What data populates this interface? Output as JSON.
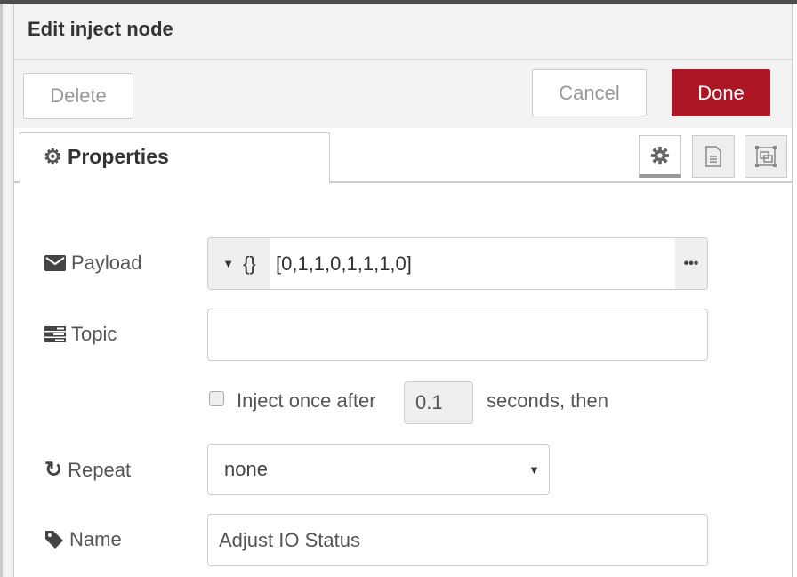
{
  "dialog": {
    "title": "Edit inject node"
  },
  "toolbar": {
    "delete": "Delete",
    "cancel": "Cancel",
    "done": "Done",
    "done_color": "#ad1625"
  },
  "tabs": {
    "properties": "Properties"
  },
  "tab_icons": [
    "gear-icon",
    "file-text-icon",
    "expand-icon"
  ],
  "form": {
    "payload": {
      "label": "Payload",
      "type_icon": "{}",
      "value": "[0,1,1,0,1,1,1,0]"
    },
    "topic": {
      "label": "Topic",
      "value": ""
    },
    "inject_once": {
      "checked": false,
      "prefix": "Inject once after",
      "delay": "0.1",
      "suffix": "seconds, then"
    },
    "repeat": {
      "label": "Repeat",
      "value": "none"
    },
    "name": {
      "label": "Name",
      "value": "Adjust IO Status"
    }
  }
}
